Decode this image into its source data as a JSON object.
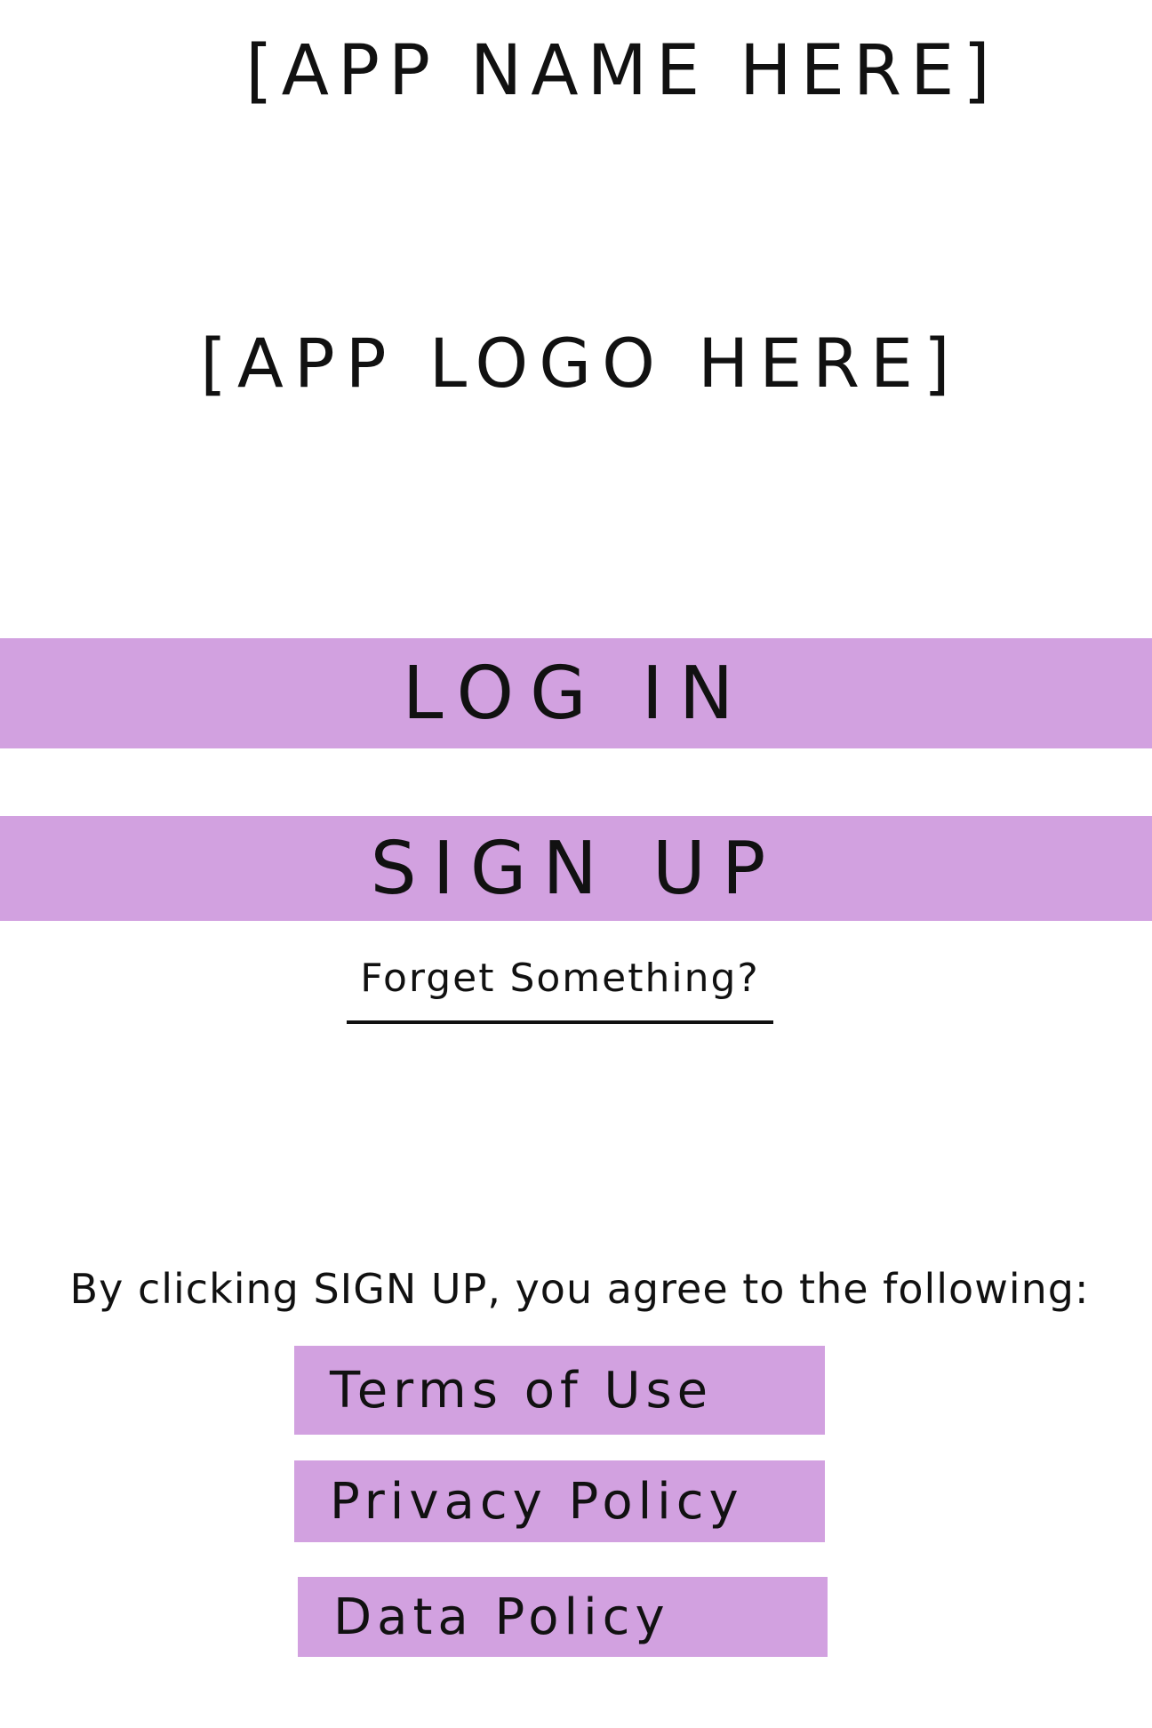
{
  "header": {
    "app_name_placeholder": "[APP NAME HERE]",
    "app_logo_placeholder": "[APP LOGO HERE]"
  },
  "actions": {
    "login_label": "LOG IN",
    "signup_label": "SIGN UP",
    "forgot_label": "Forget Something?"
  },
  "legal": {
    "agree_text": "By clicking SIGN UP, you agree to the following:",
    "terms_label": "Terms of Use",
    "privacy_label": "Privacy Policy",
    "data_label": "Data Policy"
  },
  "colors": {
    "button_fill": "#d2a1e0",
    "ink": "#111111",
    "background": "#ffffff"
  }
}
